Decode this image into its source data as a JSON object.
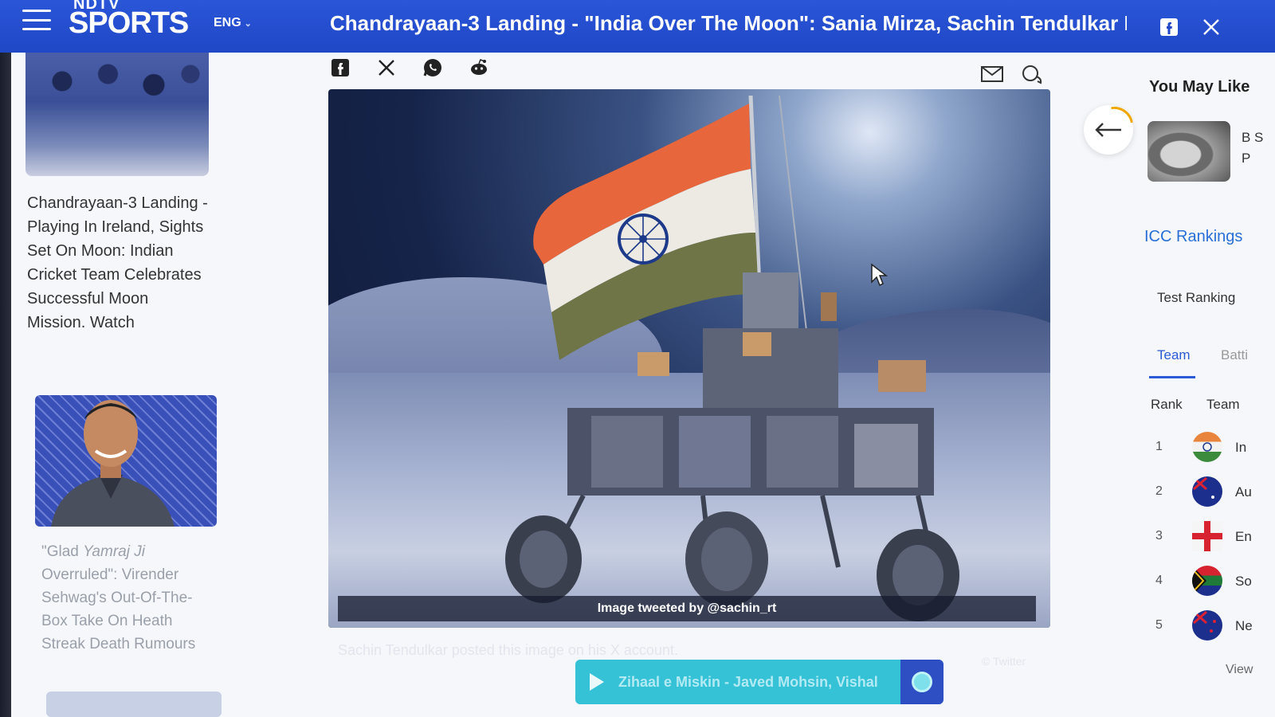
{
  "header": {
    "logo_top": "NDTV",
    "logo_main": "SPORTS",
    "language": "ENG",
    "headline": "Chandrayaan-3 Landing - \"India Over The Moon\": Sania Mirza, Sachin Tendulkar Lead",
    "share_icons": [
      "facebook-icon",
      "x-icon"
    ]
  },
  "left_column": {
    "story1_title": "Chandrayaan-3 Landing - Playing In Ireland, Sights Set On Moon: Indian Cricket Team Celebrates Successful Moon Mission. Watch",
    "story2_title_prefix": "\"Glad ",
    "story2_title_italic": "Yamraj Ji",
    "story2_title_suffix": " Overruled\": Virender Sehwag's Out-Of-The-Box Take On Heath Streak Death Rumours"
  },
  "share_bar": [
    "facebook-icon",
    "x-icon",
    "whatsapp-icon",
    "reddit-icon"
  ],
  "hero": {
    "caption": "Image tweeted by @sachin_rt",
    "sub_caption": "Sachin Tendulkar posted this image on his X account.",
    "credit": "© Twitter"
  },
  "player": {
    "song": "Zihaal e Miskin - Javed Mohsin, Vishal"
  },
  "right_column": {
    "you_may_like": "You May Like",
    "yml_text": "B S P",
    "icc_rankings": "ICC Rankings",
    "ranking_type": "Test Ranking",
    "tabs": [
      "Team",
      "Batti"
    ],
    "columns": [
      "Rank",
      "Team"
    ],
    "rows": [
      {
        "rank": "1",
        "team": "In"
      },
      {
        "rank": "2",
        "team": "Au"
      },
      {
        "rank": "3",
        "team": "En"
      },
      {
        "rank": "4",
        "team": "So"
      },
      {
        "rank": "5",
        "team": "Ne"
      }
    ],
    "view_all": "View"
  },
  "colors": {
    "header_blue": "#1f47c6",
    "accent_blue": "#2a5ad6",
    "player_teal": "#35c2d7",
    "saffron": "#e8663c",
    "india_green": "#6a7a4a"
  }
}
